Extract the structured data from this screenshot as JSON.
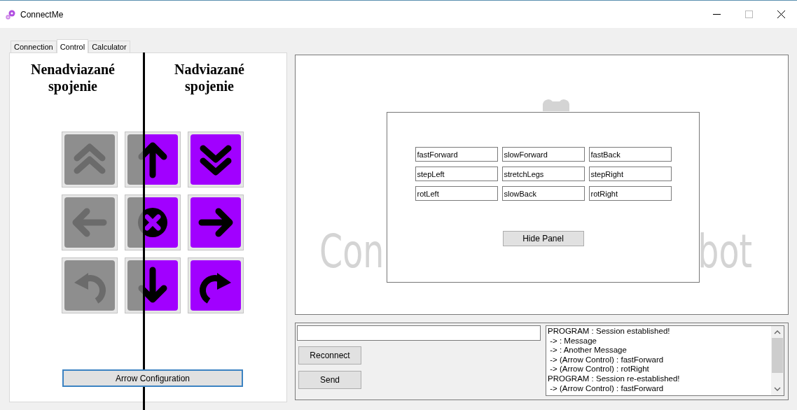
{
  "window": {
    "title": "ConnectMe"
  },
  "tabs": [
    {
      "label": "Connection",
      "selected": false
    },
    {
      "label": "Control",
      "selected": true
    },
    {
      "label": "Calculator",
      "selected": false
    }
  ],
  "control_panel": {
    "headings": [
      "Nenadviazané spojenie",
      "Nadviazané spojenie"
    ],
    "arrow_buttons": [
      {
        "kind": "disabled"
      },
      {
        "kind": "split"
      },
      {
        "kind": "enabled"
      },
      {
        "kind": "disabled"
      },
      {
        "kind": "split"
      },
      {
        "kind": "enabled"
      },
      {
        "kind": "disabled"
      },
      {
        "kind": "split"
      },
      {
        "kind": "enabled"
      }
    ],
    "config_button": "Arrow Configuration"
  },
  "logo_text": {
    "left": "Con",
    "right": "bot"
  },
  "arrow_configuration": {
    "fields": [
      "fastForward",
      "slowForward",
      "fastBack",
      "stepLeft",
      "stretchLegs",
      "stepRight",
      "rotLeft",
      "slowBack",
      "rotRight"
    ],
    "hide_button": "Hide Panel"
  },
  "buttons": [
    "Reconnect",
    "Send"
  ],
  "log": [
    "PROGRAM : Session established!",
    " -> : Message",
    " -> : Another Message",
    " -> (Arrow Control) : fastForward",
    " -> (Arrow Control) : rotRight",
    "PROGRAM : Session re-established!",
    " -> (Arrow Control) : fastForward"
  ]
}
